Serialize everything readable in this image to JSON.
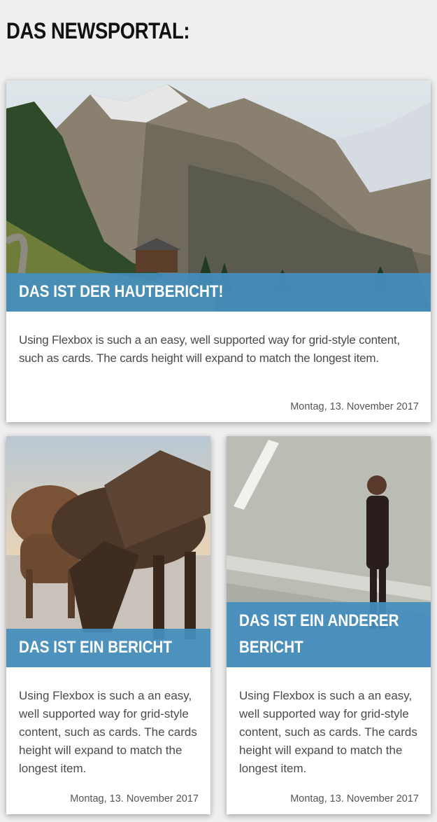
{
  "page": {
    "title": "DAS NEWSPORTAL:"
  },
  "cards": [
    {
      "image": "mountain-valley-landscape",
      "title": "DAS IST DER HAUTBERICHT!",
      "text": "Using Flexbox is such a an easy, well supported way for grid-style content, such as cards. The cards height will expand to match the longest item.",
      "date": "Montag, 13. November 2017"
    },
    {
      "image": "horses-grazing",
      "title": "DAS IST EIN BERICHT",
      "text": "Using Flexbox is such a an easy, well supported way for grid-style content, such as cards. The cards height will expand to match the longest item.",
      "date": "Montag, 13. November 2017"
    },
    {
      "image": "man-in-suit-walking",
      "title": "DAS IST EIN ANDERER BERICHT",
      "text": "Using Flexbox is such a an easy, well supported way for grid-style content, such as cards. The cards height will expand to match the longest item.",
      "date": "Montag, 13. November 2017"
    }
  ],
  "colors": {
    "caption_bg": "#448ebd",
    "page_bg": "#efefef"
  }
}
